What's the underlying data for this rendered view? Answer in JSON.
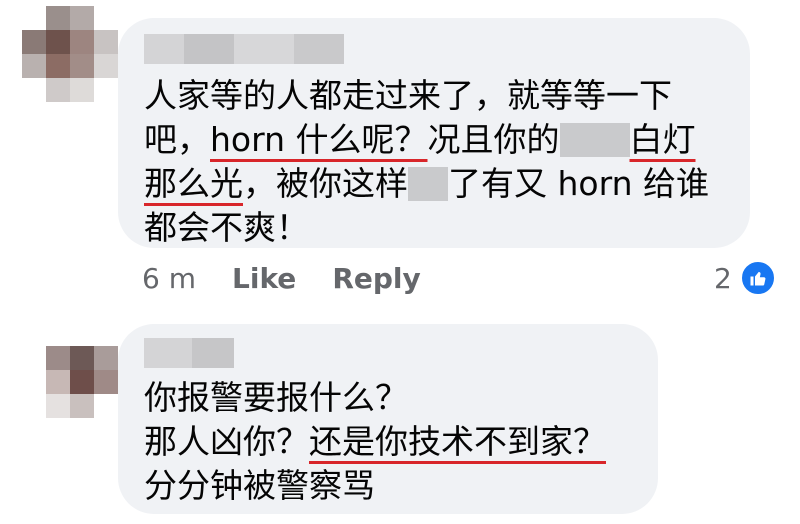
{
  "comments": [
    {
      "lines": [
        {
          "parts": [
            {
              "t": "人家等的人都走过来了，就等等一下"
            }
          ]
        },
        {
          "parts": [
            {
              "t": "吧，"
            },
            {
              "t": "horn 什么呢？",
              "u": true
            },
            {
              "t": "况且你的"
            },
            {
              "blur": 70
            },
            {
              "t": "白灯",
              "u": true
            }
          ]
        },
        {
          "parts": [
            {
              "t": "那么光",
              "u": true
            },
            {
              "t": "，被你这样"
            },
            {
              "blur": 40
            },
            {
              "t": "了有又 horn 给谁"
            }
          ]
        },
        {
          "parts": [
            {
              "t": "都会不爽！"
            }
          ]
        }
      ],
      "time": "6 m",
      "like_label": "Like",
      "reply_label": "Reply",
      "reaction_count": "2"
    },
    {
      "lines": [
        {
          "parts": [
            {
              "t": "你报警要报什么？"
            }
          ]
        },
        {
          "parts": [
            {
              "t": "那人凶你？"
            },
            {
              "t": "还是你技术不到家？",
              "u": true
            }
          ]
        },
        {
          "parts": [
            {
              "t": "分分钟被警察骂"
            }
          ]
        }
      ]
    }
  ],
  "colors": {
    "bubble": "#f0f2f5",
    "underline": "#d8262a",
    "like_blue": "#1877f2",
    "meta": "#65676b"
  },
  "icons": {
    "reaction": "like-thumb-icon"
  }
}
